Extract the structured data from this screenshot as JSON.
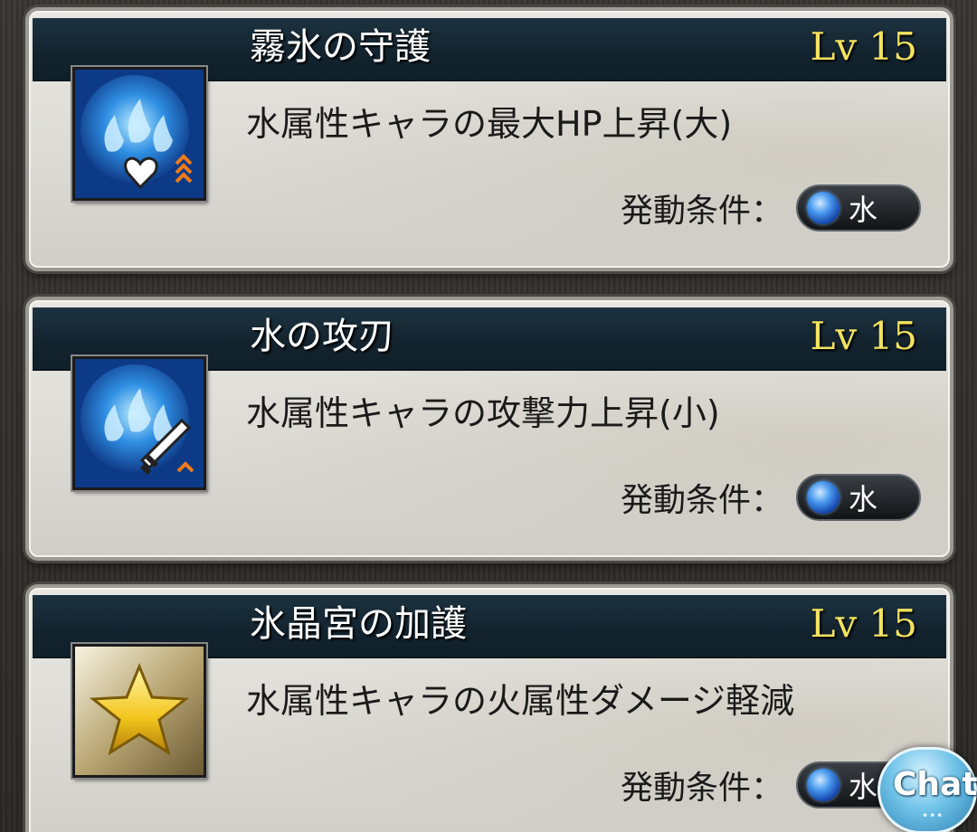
{
  "skills": [
    {
      "name": "霧氷の守護",
      "level": "Lv 15",
      "description": "水属性キャラの最大HP上昇(大)",
      "condition_label": "発動条件：",
      "element": "水",
      "icon": "water-hp-up-icon"
    },
    {
      "name": "水の攻刃",
      "level": "Lv 15",
      "description": "水属性キャラの攻撃力上昇(小)",
      "condition_label": "発動条件：",
      "element": "水",
      "icon": "water-attack-up-icon"
    },
    {
      "name": "氷晶宮の加護",
      "level": "Lv 15",
      "description": "水属性キャラの火属性ダメージ軽減",
      "condition_label": "発動条件：",
      "element": "水",
      "icon": "gold-star-icon"
    }
  ],
  "chat": {
    "label": "Chat",
    "icon": "chat-bubble-icon"
  },
  "colors": {
    "level_text": "#f3e35e",
    "header_bg": "#13232e",
    "card_bg": "#dcdbd5",
    "water_orb": "#4b9bef"
  }
}
